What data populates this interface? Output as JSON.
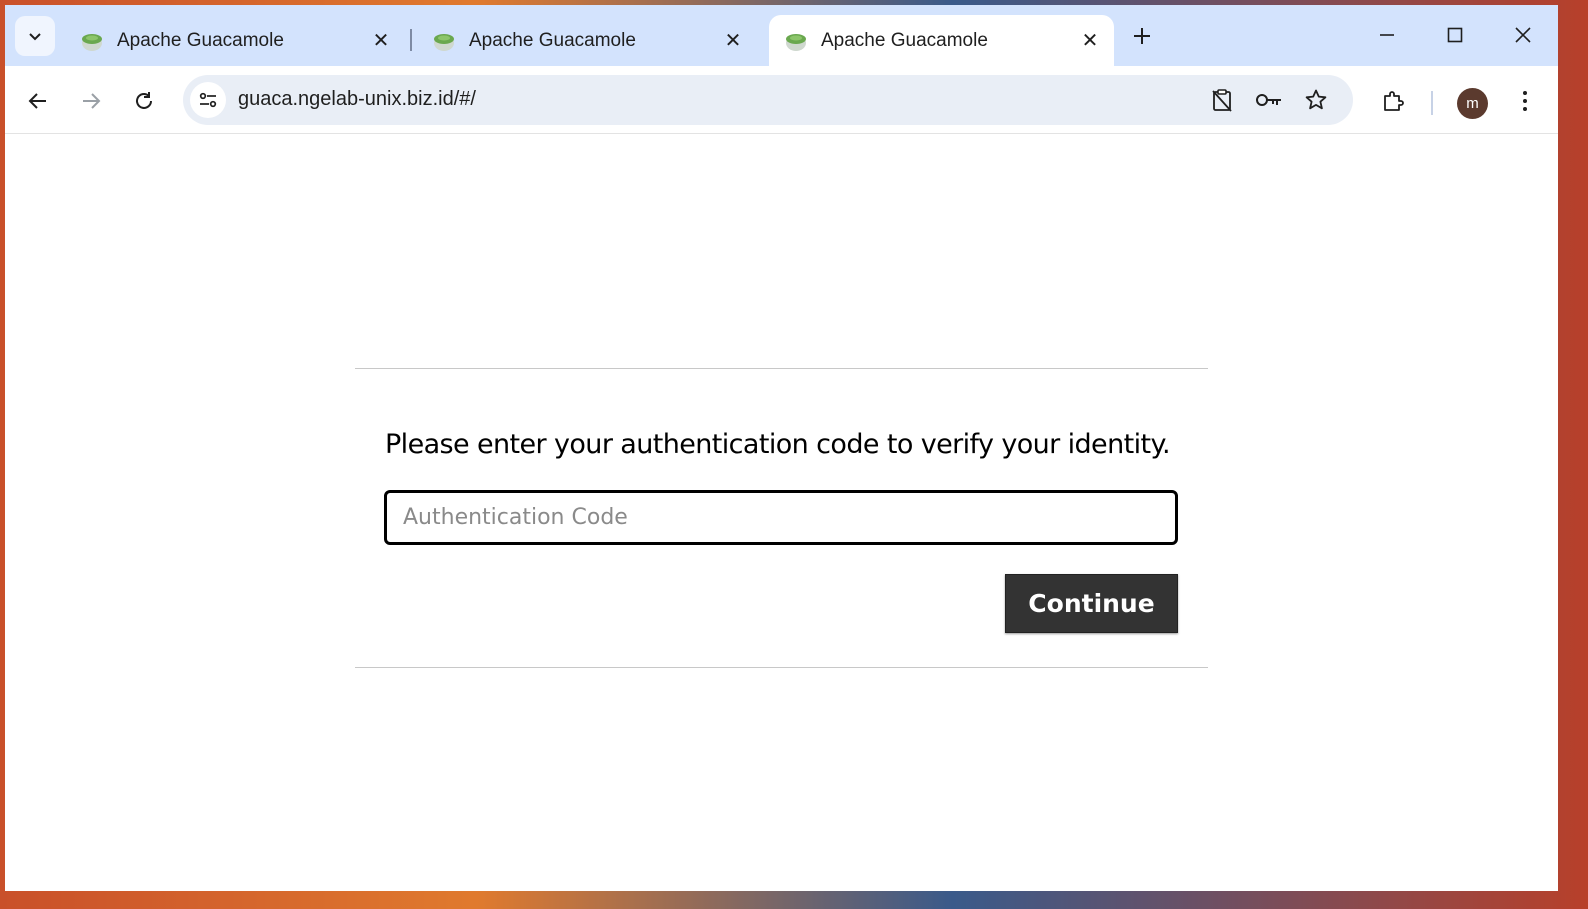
{
  "browser": {
    "tabs": [
      {
        "title": "Apache Guacamole",
        "active": false
      },
      {
        "title": "Apache Guacamole",
        "active": false
      },
      {
        "title": "Apache Guacamole",
        "active": true
      }
    ],
    "tab_close_glyph": "✕",
    "new_tab_glyph": "+",
    "url": "guaca.ngelab-unix.biz.id/#/",
    "profile_initial": "m",
    "icons": [
      "tab-search-icon",
      "back-arrow-icon",
      "forward-arrow-icon",
      "reload-icon",
      "site-info-icon",
      "clipboard-blocked-icon",
      "password-key-icon",
      "bookmark-star-icon",
      "extensions-puzzle-icon",
      "kebab-menu-icon",
      "minimize-icon",
      "maximize-icon",
      "close-window-icon"
    ]
  },
  "page": {
    "prompt": "Please enter your authentication code to verify your identity.",
    "input_placeholder": "Authentication Code",
    "input_value": "",
    "continue_label": "Continue"
  },
  "colors": {
    "tabstrip_bg": "#d3e3fd",
    "omnibox_bg": "#e9eef6",
    "button_bg": "#333333",
    "favicon_green": "#6aa84f"
  }
}
